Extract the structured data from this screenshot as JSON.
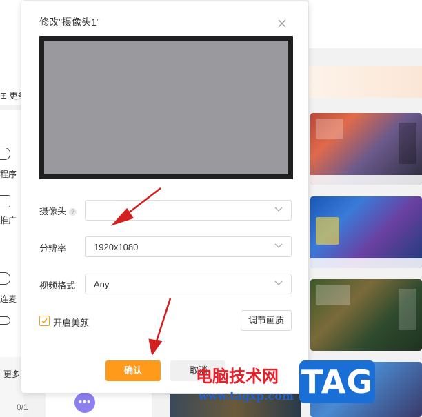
{
  "background": {
    "left_fragments": [
      {
        "text": "⊞ 更多"
      },
      {
        "text": "程序"
      },
      {
        "text": "推广"
      },
      {
        "text": "连麦"
      },
      {
        "text": "更多"
      },
      {
        "text": "0/1"
      }
    ],
    "dots_button": "•••"
  },
  "dialog": {
    "title": "修改\"摄像头1\"",
    "close_icon": "close-icon",
    "fields": {
      "camera": {
        "label": "摄像头",
        "value": "",
        "help_icon": "?"
      },
      "resolution": {
        "label": "分辨率",
        "value": "1920x1080"
      },
      "video_format": {
        "label": "视频格式",
        "value": "Any"
      }
    },
    "beauty": {
      "label": "开启美颜",
      "checked": true
    },
    "adjust_quality_button": "调节画质",
    "confirm_button": "确认",
    "cancel_button": "取消"
  },
  "watermark": {
    "site_name": "电脑技术网",
    "url": "www.tagxp.com",
    "logo_text": "TAG"
  },
  "colors": {
    "accent_orange": "#ff9a1a",
    "checkbox_orange": "#f0a020",
    "arrow_red": "#d42020",
    "watermark_red": "#e8202a",
    "watermark_blue": "#1a6fd6"
  }
}
